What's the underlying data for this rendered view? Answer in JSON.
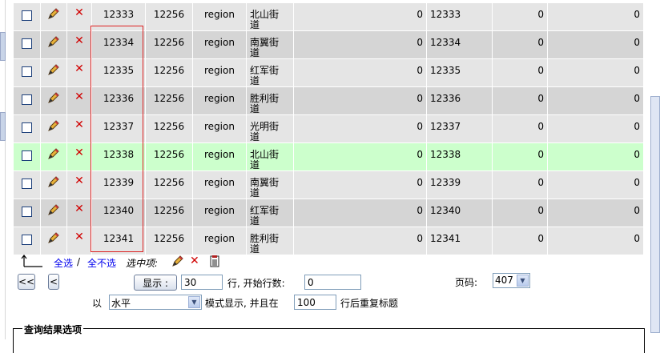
{
  "rows": [
    {
      "id": "12333",
      "parent": "12256",
      "type": "region",
      "name": "北山街道",
      "val1": "0",
      "code": "12333",
      "val2": "0",
      "val3": "0",
      "style": "odd"
    },
    {
      "id": "12334",
      "parent": "12256",
      "type": "region",
      "name": "南翼街道",
      "val1": "0",
      "code": "12334",
      "val2": "0",
      "val3": "0",
      "style": "even"
    },
    {
      "id": "12335",
      "parent": "12256",
      "type": "region",
      "name": "红军街道",
      "val1": "0",
      "code": "12335",
      "val2": "0",
      "val3": "0",
      "style": "odd"
    },
    {
      "id": "12336",
      "parent": "12256",
      "type": "region",
      "name": "胜利街道",
      "val1": "0",
      "code": "12336",
      "val2": "0",
      "val3": "0",
      "style": "even"
    },
    {
      "id": "12337",
      "parent": "12256",
      "type": "region",
      "name": "光明街道",
      "val1": "0",
      "code": "12337",
      "val2": "0",
      "val3": "0",
      "style": "odd"
    },
    {
      "id": "12338",
      "parent": "12256",
      "type": "region",
      "name": "北山街道",
      "val1": "0",
      "code": "12338",
      "val2": "0",
      "val3": "0",
      "style": "hl"
    },
    {
      "id": "12339",
      "parent": "12256",
      "type": "region",
      "name": "南翼街道",
      "val1": "0",
      "code": "12339",
      "val2": "0",
      "val3": "0",
      "style": "odd"
    },
    {
      "id": "12340",
      "parent": "12256",
      "type": "region",
      "name": "红军街道",
      "val1": "0",
      "code": "12340",
      "val2": "0",
      "val3": "0",
      "style": "even"
    },
    {
      "id": "12341",
      "parent": "12256",
      "type": "region",
      "name": "胜利街道",
      "val1": "0",
      "code": "12341",
      "val2": "0",
      "val3": "0",
      "style": "odd"
    }
  ],
  "selection": {
    "check_all": "全选",
    "separator": " / ",
    "uncheck_all": "全不选",
    "with_selected": "选中项:"
  },
  "nav": {
    "first": "<<",
    "prev": "<",
    "show_button": "显示 :",
    "rows_value": "30",
    "rows_label": "行, 开始行数:",
    "start_value": "0",
    "page_label": "页码:",
    "page_value": "407",
    "mode_prefix": "以",
    "mode_value": "水平",
    "mode_label": "模式显示, 并且在",
    "repeat_value": "100",
    "repeat_label": "行后重复标题"
  },
  "query_options": {
    "legend": "查询结果选项"
  },
  "colors": {
    "row_odd": "#e5e5e5",
    "row_even": "#d5d5d5",
    "row_highlight": "#ccffcc",
    "delete_red": "#d00000",
    "link_blue": "#0000ee"
  }
}
